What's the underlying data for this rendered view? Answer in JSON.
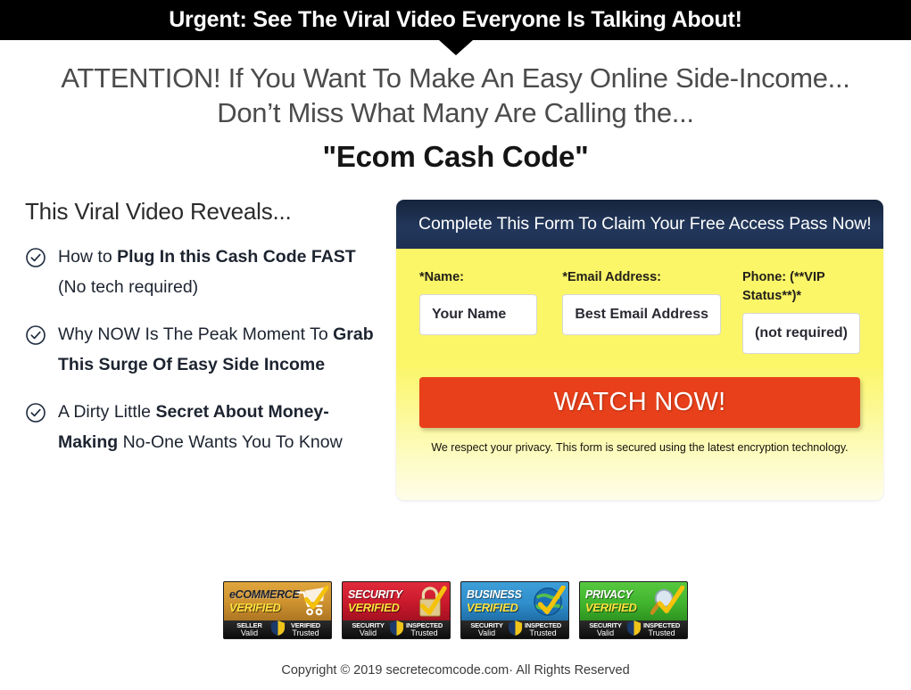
{
  "urgent_bar": {
    "text": "Urgent: See The Viral Video Everyone Is Talking About!"
  },
  "headline": {
    "line1": "ATTENTION! If You Want To Make An Easy Online Side-Income...",
    "line2": "Don’t Miss What Many Are Calling the...",
    "line3": "\"Ecom Cash Code\""
  },
  "left_column": {
    "title": "This Viral Video Reveals...",
    "bullets": [
      {
        "icon": "check-circle-icon",
        "parts": [
          {
            "text": "How to ",
            "bold": false
          },
          {
            "text": "Plug In this Cash Code FAST ",
            "bold": true
          },
          {
            "text": "(No tech required)",
            "bold": false
          }
        ]
      },
      {
        "icon": "check-circle-icon",
        "parts": [
          {
            "text": "Why NOW Is The Peak Moment To ",
            "bold": false
          },
          {
            "text": "Grab This Surge Of Easy Side Income",
            "bold": true
          }
        ]
      },
      {
        "icon": "check-circle-icon",
        "parts": [
          {
            "text": "A Dirty Little ",
            "bold": false
          },
          {
            "text": "Secret About Money-Making ",
            "bold": true
          },
          {
            "text": "No-One Wants You To Know",
            "bold": false
          }
        ]
      }
    ]
  },
  "form": {
    "header_title": "Complete This Form To Claim Your Free Access Pass Now!",
    "fields": [
      {
        "label": "*Name:",
        "placeholder": "Your Name",
        "name": "name-field"
      },
      {
        "label": "*Email Address:",
        "placeholder": "Best Email Address",
        "name": "email-field"
      },
      {
        "label": "Phone: (**VIP Status**)*",
        "placeholder": "(not required)",
        "name": "phone-field"
      }
    ],
    "cta_label": "WATCH NOW!",
    "privacy_note": "We respect your privacy. This form is secured using the latest encryption technology.",
    "colors": {
      "header_navy": "#1d3053",
      "body_yellow": "#fbf667",
      "cta_orange": "#e8401a"
    }
  },
  "badges": [
    {
      "icon": "shopping-cart-icon",
      "word1": "eCOMMERCE",
      "word2": "VERIFIED",
      "left_top": "SELLER",
      "left_bottom": "Valid",
      "right_top": "VERIFIED",
      "right_bottom": "Trusted",
      "color": "#cf9330",
      "theme": "gold"
    },
    {
      "icon": "padlock-icon",
      "word1": "SECURITY",
      "word2": "VERIFIED",
      "left_top": "SECURITY",
      "left_bottom": "Valid",
      "right_top": "INSPECTED",
      "right_bottom": "Trusted",
      "color": "#c8192b",
      "theme": "red"
    },
    {
      "icon": "globe-icon",
      "word1": "BUSINESS",
      "word2": "VERIFIED",
      "left_top": "SECURITY",
      "left_bottom": "Valid",
      "right_top": "INSPECTED",
      "right_bottom": "Trusted",
      "color": "#2f8ecb",
      "theme": "blue"
    },
    {
      "icon": "magnifier-icon",
      "word1": "PRIVACY",
      "word2": "VERIFIED",
      "left_top": "SECURITY",
      "left_bottom": "Valid",
      "right_top": "INSPECTED",
      "right_bottom": "Trusted",
      "color": "#41b42e",
      "theme": "green"
    }
  ],
  "footer": {
    "copyright": "Copyright © 2019 secretecomcode.com· All Rights Reserved"
  }
}
